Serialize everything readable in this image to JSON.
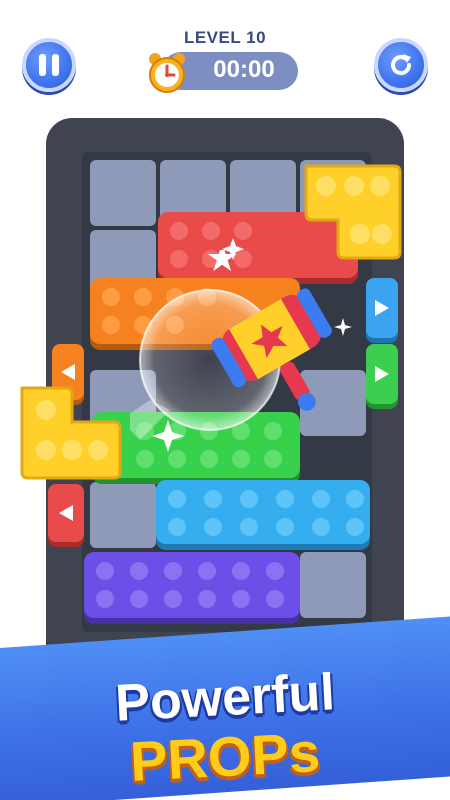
{
  "hud": {
    "level_label": "LEVEL 10",
    "timer": "00:00",
    "pause_icon": "pause-icon",
    "restart_icon": "restart-icon",
    "clock_icon": "alarm-clock-icon"
  },
  "board": {
    "bricks": [
      {
        "color": "red",
        "hex": "#e94a4a"
      },
      {
        "color": "orange",
        "hex": "#f5811f"
      },
      {
        "color": "green",
        "hex": "#38d14b"
      },
      {
        "color": "light-blue",
        "hex": "#35aef0"
      },
      {
        "color": "purple",
        "hex": "#6b4fe6"
      },
      {
        "color": "yellow",
        "hex": "#ffd02a"
      }
    ],
    "prop": "hammer-icon"
  },
  "banner": {
    "line1": "Powerful",
    "line2": "PROPs"
  },
  "colors": {
    "accent_blue": "#3f74ee",
    "banner_blue": "#3d6fe6",
    "banner_yellow": "#ffcc1a"
  }
}
